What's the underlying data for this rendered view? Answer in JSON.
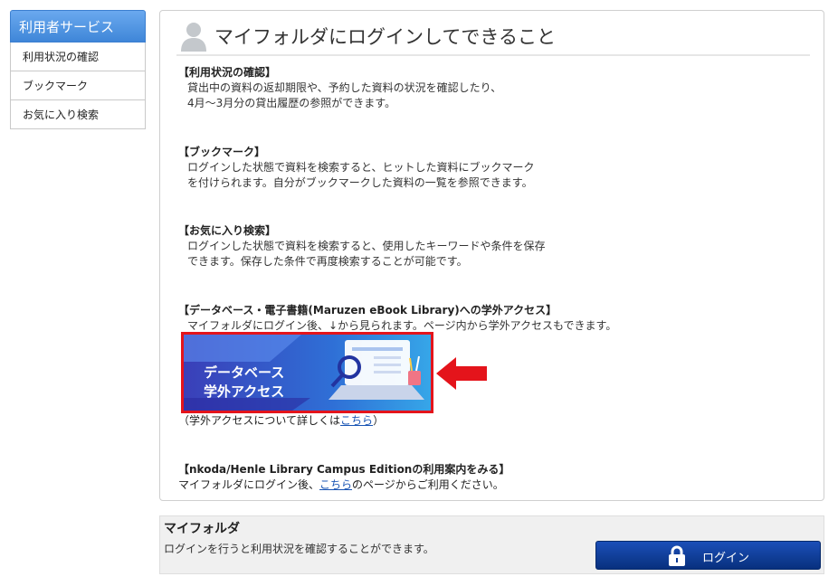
{
  "sidebar": {
    "header": "利用者サービス",
    "items": [
      {
        "label": "利用状況の確認"
      },
      {
        "label": "ブックマーク"
      },
      {
        "label": "お気に入り検索"
      }
    ]
  },
  "main": {
    "title": "マイフォルダにログインしてできること",
    "sections": [
      {
        "heading": "【利用状況の確認】",
        "lines": [
          "貸出中の資料の返却期限や、予約した資料の状況を確認したり、",
          "4月～3月分の貸出履歴の参照ができます。"
        ]
      },
      {
        "heading": "【ブックマーク】",
        "lines": [
          "ログインした状態で資料を検索すると、ヒットした資料にブックマーク",
          "を付けられます。自分がブックマークした資料の一覧を参照できます。"
        ]
      },
      {
        "heading": "【お気に入り検索】",
        "lines": [
          "ログインした状態で資料を検索すると、使用したキーワードや条件を保存",
          "できます。保存した条件で再度検索することが可能です。"
        ]
      },
      {
        "heading": "【データベース・電子書籍(Maruzen eBook Library)への学外アクセス】",
        "lines": [
          "マイフォルダにログイン後、↓から見られます。ページ内から学外アクセスもできます。"
        ]
      }
    ],
    "banner": {
      "line1": "データベース",
      "line2": "学外アクセス"
    },
    "remote_note": {
      "prefix": "（学外アクセスについて詳しくは",
      "link": "こちら",
      "suffix": "）"
    },
    "nkoda": {
      "heading": "【nkoda/Henle Library Campus Editionの利用案内をみる】",
      "prefix": "マイフォルダにログイン後、",
      "link": "こちら",
      "suffix": "のページからご利用ください。"
    }
  },
  "login": {
    "title": "マイフォルダ",
    "description": "ログインを行うと利用状況を確認することができます。",
    "button": "ログイン"
  },
  "colors": {
    "accent": "#3f86d8",
    "highlight": "#e4141b",
    "button": "#0a3a94"
  }
}
